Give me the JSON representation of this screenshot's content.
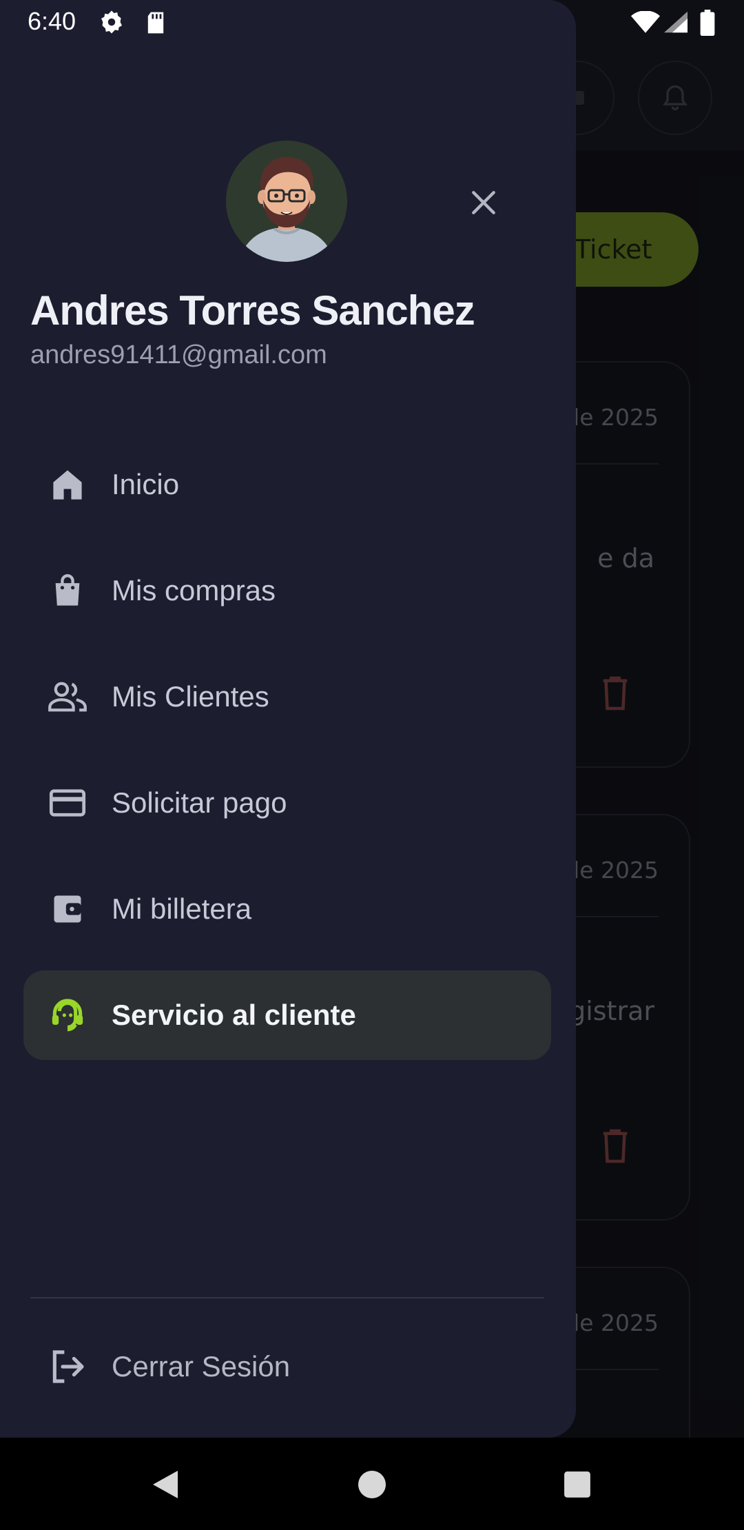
{
  "status_bar": {
    "time": "6:40"
  },
  "background": {
    "ticket_button_label": "Ticket",
    "cards": [
      {
        "date_fragment": "de 2025",
        "text_fragment": "e da"
      },
      {
        "date_fragment": "de 2025",
        "text_fragment": "gistrar"
      },
      {
        "date_fragment": "de 2025",
        "text_fragment": ""
      }
    ]
  },
  "drawer": {
    "user": {
      "name": "Andres Torres Sanchez",
      "email": "andres91411@gmail.com"
    },
    "menu": [
      {
        "label": "Inicio",
        "icon": "home-icon"
      },
      {
        "label": "Mis compras",
        "icon": "shopping-bag-icon"
      },
      {
        "label": "Mis Clientes",
        "icon": "people-icon"
      },
      {
        "label": "Solicitar pago",
        "icon": "credit-card-icon"
      },
      {
        "label": "Mi billetera",
        "icon": "wallet-icon"
      },
      {
        "label": "Servicio al cliente",
        "icon": "support-agent-icon",
        "active": true
      }
    ],
    "logout_label": "Cerrar Sesión"
  },
  "colors": {
    "drawer_bg": "#1c1d2f",
    "accent_green": "#9ad62a",
    "active_item_bg": "#2c3032",
    "ticket_button": "#6f8c25"
  }
}
